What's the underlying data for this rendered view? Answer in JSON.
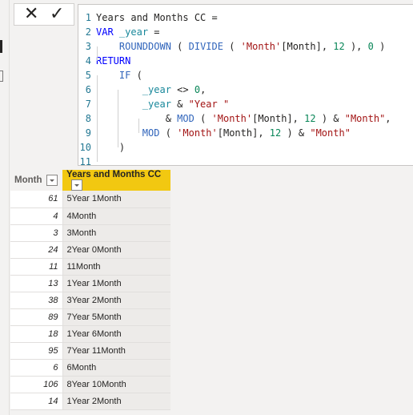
{
  "toolbar": {
    "cancel_icon": "✕",
    "commit_icon": "✓"
  },
  "editor": {
    "lines": [
      {
        "n": "1",
        "t": "Years and Months CC ="
      },
      {
        "n": "2",
        "t": "VAR _year ="
      },
      {
        "n": "3",
        "t": "    ROUNDDOWN ( DIVIDE ( 'Month'[Month], 12 ), 0 )"
      },
      {
        "n": "4",
        "t": "RETURN"
      },
      {
        "n": "5",
        "t": "    IF ("
      },
      {
        "n": "6",
        "t": "        _year <> 0,"
      },
      {
        "n": "7",
        "t": "        _year & \"Year \""
      },
      {
        "n": "8",
        "t": "            & MOD ( 'Month'[Month], 12 ) & \"Month\","
      },
      {
        "n": "9",
        "t": "        MOD ( 'Month'[Month], 12 ) & \"Month\""
      },
      {
        "n": "10",
        "t": "    )"
      },
      {
        "n": "11",
        "t": ""
      }
    ]
  },
  "table": {
    "columns": [
      "Month",
      "Years and Months CC"
    ],
    "selected_column": "Years and Months CC",
    "rows": [
      [
        "61",
        "5Year 1Month"
      ],
      [
        "4",
        "4Month"
      ],
      [
        "3",
        "3Month"
      ],
      [
        "24",
        "2Year 0Month"
      ],
      [
        "11",
        "11Month"
      ],
      [
        "13",
        "1Year 1Month"
      ],
      [
        "38",
        "3Year 2Month"
      ],
      [
        "89",
        "7Year 5Month"
      ],
      [
        "18",
        "1Year 6Month"
      ],
      [
        "95",
        "7Year 11Month"
      ],
      [
        "6",
        "6Month"
      ],
      [
        "106",
        "8Year 10Month"
      ],
      [
        "14",
        "1Year 2Month"
      ]
    ]
  },
  "colors": {
    "selected_header": "#f2c811",
    "keyword": "#0000ff",
    "function": "#3165bb",
    "variable": "#19889b",
    "string": "#a31515",
    "number": "#098658"
  }
}
